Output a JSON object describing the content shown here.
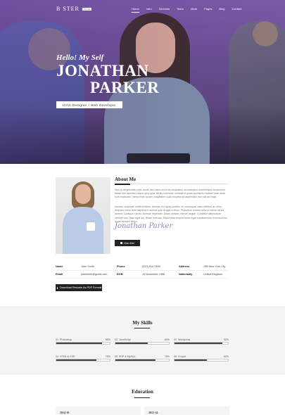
{
  "nav": {
    "logo_text": "B   STER",
    "logo_tag": "STYLE",
    "items": [
      {
        "label": "Home",
        "active": true
      },
      {
        "label": "Intro"
      },
      {
        "label": "Services"
      },
      {
        "label": "Team"
      },
      {
        "label": "Work"
      },
      {
        "label": "Pages"
      },
      {
        "label": "Blog"
      },
      {
        "label": "Contact"
      }
    ]
  },
  "hero": {
    "greeting": "Hello! My Self",
    "first_name": "JONATHAN",
    "last_name": "PARKER",
    "role": "UI/UI Designer / Web Developer"
  },
  "about": {
    "title": "About Me",
    "paragraph1": "Sed ut perspiciatis unde omnis iste natus error sit voluptatem accusantium doloremque laudantium totam rem aperiam eaque ipsa quae ab illo inventore veritatis et quasi architecto beatae vitae dicta sunt explicabo. Nemo enim ipsam voluptatem quia voluptas sit aspernatur aut odit aut fugit.",
    "paragraph2": "Aenean vulputate eleifend tellus. Aenean leo ligula porttitor eu consequat vitae eleifend ac enim. Aliquam lorem ante dapibus in viverra quis feugiat a tellus. Phasellus viverra nulla ut metus varius laoreet. Quisque rutrum. Aenean imperdiet. Etiam ultricies nisi vel augue. Curabitur ullamcorper ultricies nisi. Nam eget dui. Etiam rhoncus. Maecenas tempus tellus eget condimentum rhoncus sem quam semper libero.",
    "signature": "Jonathan Parker",
    "hire_label": "Hire Me!"
  },
  "info": {
    "name_label": "Name",
    "name_value": "John Smith",
    "phone_label": "Phone",
    "phone_value": "(323) 914 7895",
    "address_label": "Address",
    "address_value": "29B New York City",
    "email_label": "Email",
    "email_value": "johnsmith@gmail.com",
    "dob_label": "DOB",
    "dob_value": "16 November 1986",
    "nationality_label": "Nationality",
    "nationality_value": "United Kingdom"
  },
  "resume_label": "Download Resume As PDF Format",
  "skills": {
    "title": "My Skills",
    "items": [
      {
        "num": "01",
        "name": "Photoshop",
        "percent": 85,
        "label": "85%"
      },
      {
        "num": "02",
        "name": "JavaScript",
        "percent": 60,
        "label": "60%"
      },
      {
        "num": "03",
        "name": "Wordpress",
        "percent": 90,
        "label": "90%"
      },
      {
        "num": "04",
        "name": "HTML & CSS",
        "percent": 75,
        "label": "75%"
      },
      {
        "num": "05",
        "name": "PHP & MySQL",
        "percent": 75,
        "label": "75%"
      },
      {
        "num": "06",
        "name": "Drupal",
        "percent": 60,
        "label": "60%"
      }
    ]
  },
  "education": {
    "title": "Education",
    "cards": [
      {
        "years": "2014-16"
      },
      {
        "years": "2012-14"
      }
    ]
  },
  "colors": {
    "accent": "#222222",
    "hero_tint": "#6a4e92",
    "section_bg": "#f4f4f4"
  }
}
